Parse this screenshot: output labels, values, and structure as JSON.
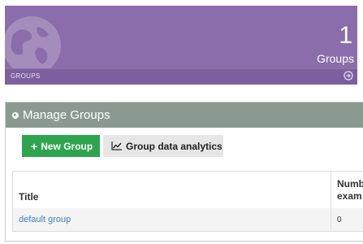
{
  "stat_tile": {
    "count": "1",
    "label": "Groups",
    "footer_label": "GROUPS"
  },
  "panel": {
    "title": "Manage Groups",
    "new_group_label": "New Group",
    "analytics_label": "Group data analytics"
  },
  "table": {
    "headers": [
      "Title",
      "Numb exam"
    ],
    "header_exam_line1": "Numb",
    "header_exam_line2": "exam",
    "rows": [
      {
        "title": "default group",
        "count": "0"
      }
    ]
  },
  "colors": {
    "tile": "#8a6daa",
    "panel_header": "#8b9a91",
    "primary_button": "#2ea44f",
    "link": "#3d7fbf"
  },
  "icons": [
    "globe-icon",
    "circle-arrow-right-icon",
    "globe-small-icon",
    "plus-icon",
    "line-chart-icon"
  ]
}
